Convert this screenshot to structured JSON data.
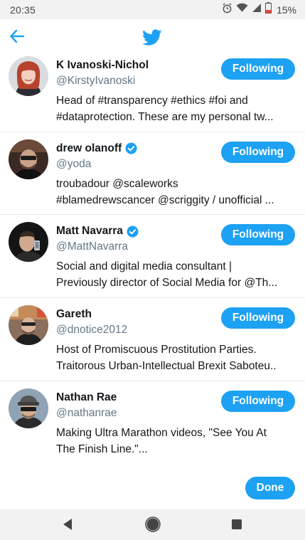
{
  "status_bar": {
    "time": "20:35",
    "battery_percent": "15%",
    "icons": [
      "alarm-icon",
      "wifi-icon",
      "signal-icon",
      "battery-icon"
    ]
  },
  "app_bar": {
    "back_icon": "arrow-left-icon",
    "logo_icon": "twitter-bird-icon",
    "accent_color": "#1da1f2"
  },
  "users": [
    {
      "name": "K Ivanoski-Nichol",
      "handle": "@KirstyIvanoski",
      "verified": false,
      "bio_lines": [
        "Head of #transparency #ethics #foi and",
        "#dataprotection. These are my personal tw..."
      ],
      "follow_label": "Following"
    },
    {
      "name": "drew olanoff",
      "handle": "@yoda",
      "verified": true,
      "bio_lines": [
        "troubadour @scaleworks",
        "#blamedrewscancer @scriggity / unofficial ..."
      ],
      "follow_label": "Following"
    },
    {
      "name": "Matt Navarra",
      "handle": "@MattNavarra",
      "verified": true,
      "bio_lines": [
        "Social and digital media consultant |",
        "Previously director of Social Media for @Th..."
      ],
      "follow_label": "Following"
    },
    {
      "name": "Gareth",
      "handle": "@dnotice2012",
      "verified": false,
      "bio_lines": [
        "Host of Promiscuous Prostitution Parties.",
        "Traitorous Urban-Intellectual Brexit Saboteu..."
      ],
      "follow_label": "Following"
    },
    {
      "name": "Nathan Rae",
      "handle": "@nathanrae",
      "verified": false,
      "bio_lines": [
        "Making Ultra Marathon videos, \"See You At",
        "The Finish Line.\"..."
      ],
      "follow_label": "Following"
    }
  ],
  "footer": {
    "done_label": "Done"
  },
  "nav_bar": {
    "icons": [
      "back-triangle-icon",
      "home-circle-icon",
      "recents-square-icon"
    ]
  }
}
